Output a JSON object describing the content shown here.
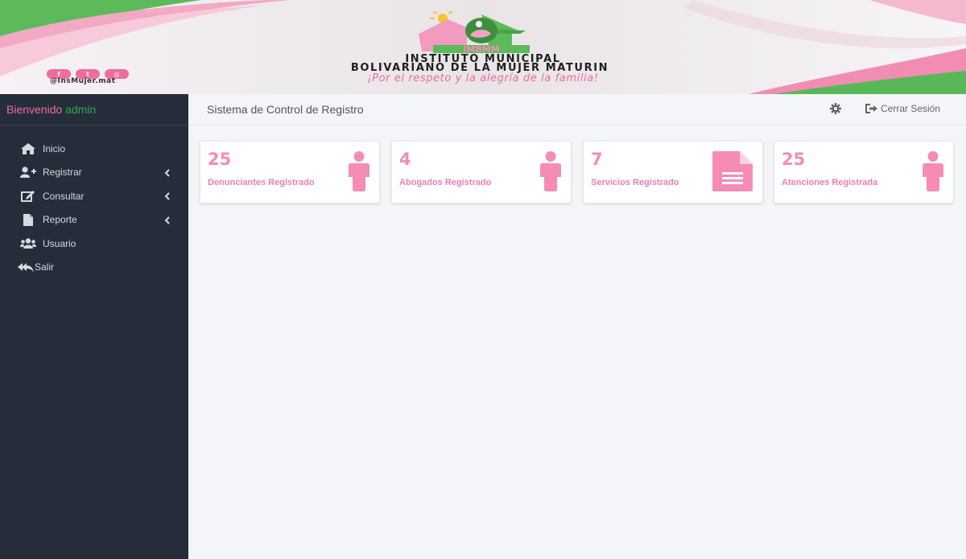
{
  "banner": {
    "social": [
      "f",
      "t",
      "◎"
    ],
    "handle": "@InsMujer.mat",
    "logo_text": "IMBMM",
    "institute_line1": "INSTITUTO MUNICIPAL",
    "institute_line2": "BOLIVARIANO DE LA MUJER MATURIN",
    "slogan": "¡Por el respeto y la alegría de la familia!"
  },
  "sidebar": {
    "welcome": "Bienvenido",
    "username": "admin",
    "items": [
      {
        "label": "Inicio",
        "icon": "home-icon",
        "submenu": false
      },
      {
        "label": "Registrar",
        "icon": "user-plus-icon",
        "submenu": true
      },
      {
        "label": "Consultar",
        "icon": "edit-icon",
        "submenu": true
      },
      {
        "label": "Reporte",
        "icon": "file-icon",
        "submenu": true
      },
      {
        "label": "Usuario",
        "icon": "users-icon",
        "submenu": false
      },
      {
        "label": "Salir",
        "icon": "reply-all-icon",
        "submenu": false
      }
    ]
  },
  "topbar": {
    "title": "Sistema de Control de Registro",
    "settings_icon": "gear-icon",
    "logout_label": "Cerrar Sesión"
  },
  "cards": [
    {
      "count": "25",
      "label": "Denunciantes Registrado",
      "icon": "person-icon"
    },
    {
      "count": "4",
      "label": "Abogados Registrado",
      "icon": "person-icon"
    },
    {
      "count": "7",
      "label": "Servicios Registrado",
      "icon": "document-icon"
    },
    {
      "count": "25",
      "label": "Atenciones Registrada",
      "icon": "person-icon"
    }
  ],
  "colors": {
    "accent_pink": "#f06c9b",
    "brand_green": "#2fa84f",
    "sidebar_bg": "#252d3a",
    "card_icon": "#f48cb6"
  }
}
